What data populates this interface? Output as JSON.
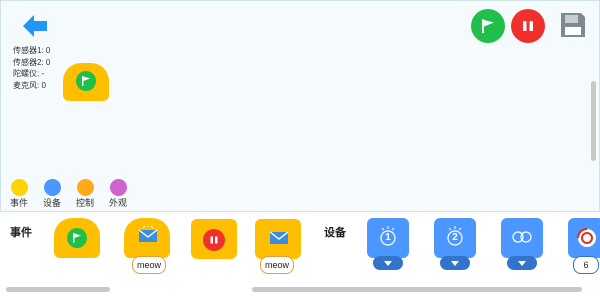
{
  "sensors": {
    "sensor1": "传感器1: 0",
    "sensor2": "传感器2: 0",
    "gyro": "陀螺仪: -",
    "mic": "麦克风: 0"
  },
  "categories": [
    {
      "label": "事件",
      "color": "#ffd500"
    },
    {
      "label": "设备",
      "color": "#4c97ff"
    },
    {
      "label": "控制",
      "color": "#ffab19"
    },
    {
      "label": "外观",
      "color": "#cf63cf"
    }
  ],
  "sections": {
    "events": "事件",
    "devices": "设备"
  },
  "blocks": {
    "broadcast_receive_value": "meow",
    "broadcast_send_value": "meow",
    "motor_value": "6"
  },
  "device_blocks": {
    "label1": "1",
    "label2": "2"
  },
  "icons": {
    "back": "back-arrow-icon",
    "green_flag": "green-flag-icon",
    "stop": "stop-icon",
    "save": "floppy-disk-icon"
  },
  "colors": {
    "accent_blue": "#2196f3",
    "flag_green": "#1fbf4a",
    "stop_red": "#f0302a",
    "event_yellow": "#ffbf00",
    "device_blue": "#4c97ff"
  }
}
